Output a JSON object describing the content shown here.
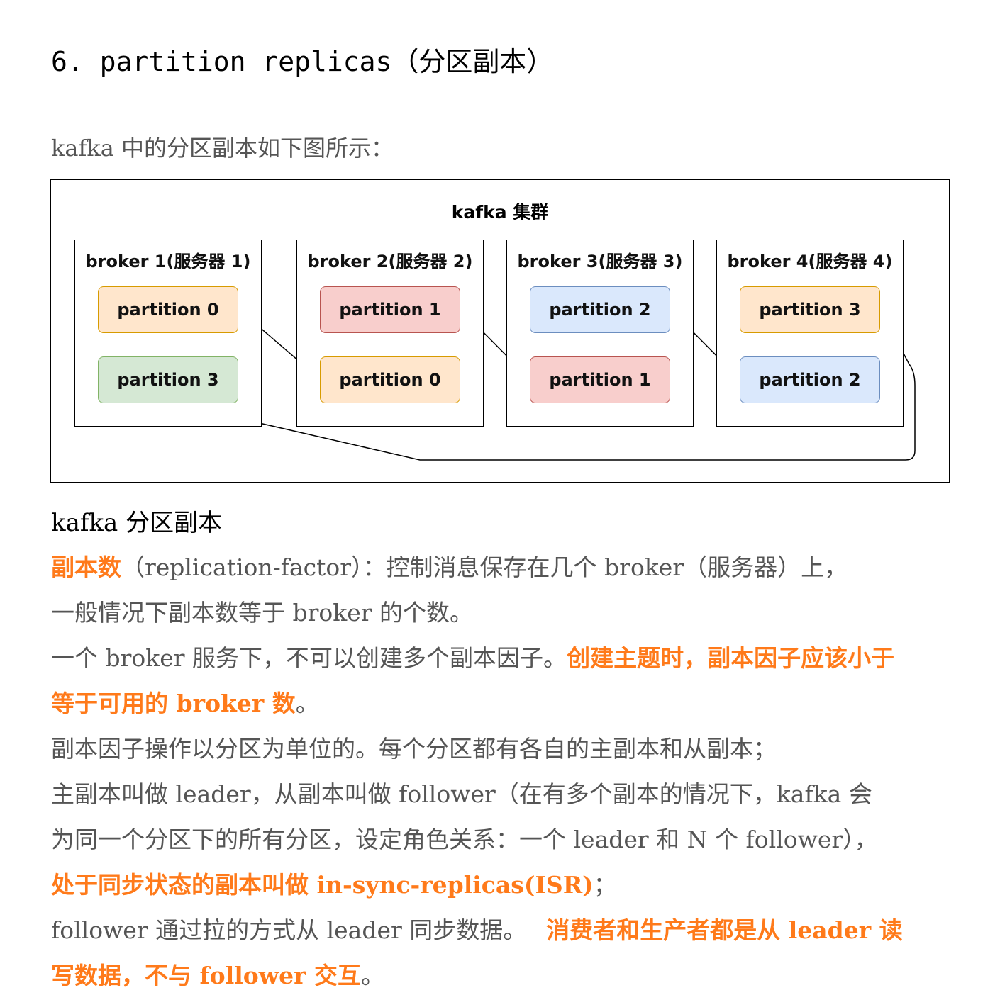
{
  "heading": "6. partition replicas（分区副本）",
  "intro": "kafka 中的分区副本如下图所示：",
  "diagram": {
    "cluster_title": "kafka 集群",
    "brokers": [
      {
        "label": "broker 1(服务器 1)",
        "partitions": [
          "partition 0",
          "partition 3"
        ]
      },
      {
        "label": "broker 2(服务器 2)",
        "partitions": [
          "partition 1",
          "partition 0"
        ]
      },
      {
        "label": "broker 3(服务器 3)",
        "partitions": [
          "partition 2",
          "partition 1"
        ]
      },
      {
        "label": "broker 4(服务器 4)",
        "partitions": [
          "partition 3",
          "partition 2"
        ]
      }
    ],
    "colors": {
      "partition_0": "#ffe6cc",
      "partition_1": "#f8cecc",
      "partition_2": "#dae8fc",
      "partition_3_leader": "#ffe6cc",
      "partition_3_replica": "#d5e8d4",
      "highlight_text": "#ff7a1a"
    }
  },
  "caption": "kafka 分区副本",
  "paragraphs": {
    "p1a_hl": "副本数",
    "p1b": "（replication-factor）：控制消息保存在几个 broker（服务器）上，",
    "p2": "一般情况下副本数等于 broker 的个数。",
    "p3a": "一个 broker 服务下，不可以创建多个副本因子。",
    "p3b_hl": "创建主题时，副本因子应该小于",
    "p4a_hl": "等于可用的 broker 数",
    "p4b": "。",
    "p5": "副本因子操作以分区为单位的。每个分区都有各自的主副本和从副本；",
    "p6": "主副本叫做 leader，从副本叫做 follower（在有多个副本的情况下，kafka 会",
    "p7": "为同一个分区下的所有分区，设定角色关系：一个 leader 和 N 个 follower），",
    "p8a_hl": "处于同步状态的副本叫做 in-sync-replicas(ISR)",
    "p8b": "；",
    "p9a": "follower 通过拉的方式从 leader 同步数据。",
    "p9b_hl": "消费者和生产者都是从 leader 读",
    "p10a_hl": "写数据，不与 follower 交互",
    "p10b": "。"
  }
}
